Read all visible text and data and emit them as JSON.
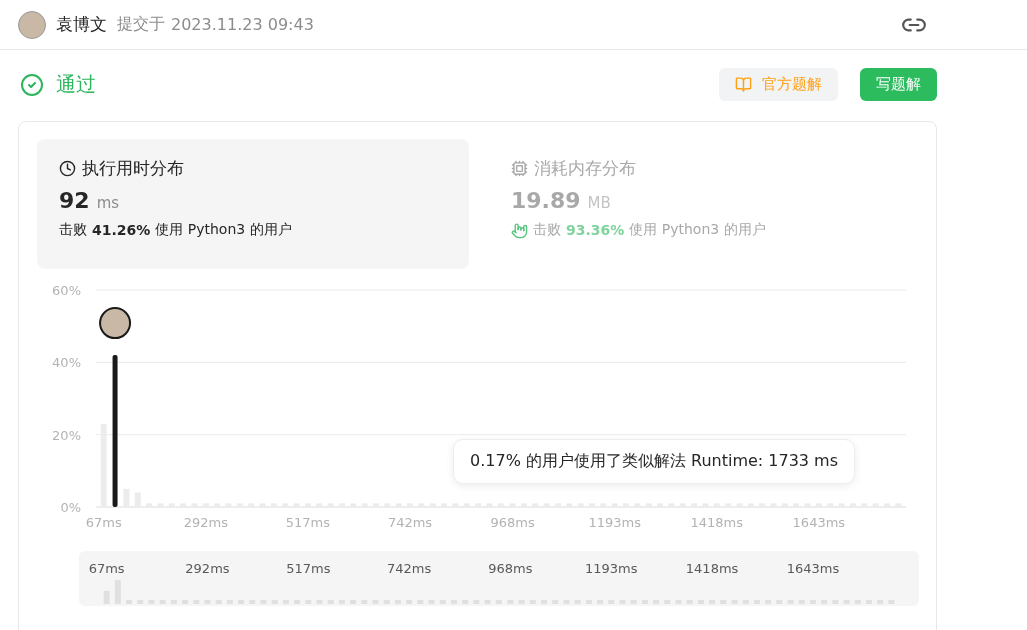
{
  "header": {
    "user": "袁博文",
    "submitted_label": "提交于",
    "submitted_time": "2023.11.23 09:43"
  },
  "status": {
    "label": "通过",
    "passed": true
  },
  "actions": [
    {
      "label": "官方题解",
      "kind": "secondary"
    },
    {
      "label": "写题解",
      "kind": "primary"
    }
  ],
  "stats": [
    {
      "title": "执行用时分布",
      "value": "92",
      "unit": "ms",
      "beat_prefix": "击败",
      "beat": "41.26%",
      "beat_suffix": "使用 Python3 的用户",
      "selected": true,
      "kind": "runtime"
    },
    {
      "title": "消耗内存分布",
      "value": "19.89",
      "unit": "MB",
      "beat_prefix": "击败",
      "beat": "93.36%",
      "beat_suffix": "使用 Python3 的用户",
      "selected": false,
      "kind": "memory"
    }
  ],
  "runtime_chart": {
    "tooltip": "0.17% 的用户使用了类似解法 Runtime: 1733 ms",
    "chart_data": {
      "type": "bar",
      "ylim": [
        0,
        60
      ],
      "yticks": [
        {
          "value": 0,
          "label": "0%"
        },
        {
          "value": 20,
          "label": "20%"
        },
        {
          "value": 40,
          "label": "40%"
        },
        {
          "value": 60,
          "label": "60%"
        }
      ],
      "xticks": [
        {
          "value": 67,
          "label": "67ms"
        },
        {
          "value": 292,
          "label": "292ms"
        },
        {
          "value": 517,
          "label": "517ms"
        },
        {
          "value": 742,
          "label": "742ms"
        },
        {
          "value": 968,
          "label": "968ms"
        },
        {
          "value": 1193,
          "label": "1193ms"
        },
        {
          "value": 1418,
          "label": "1418ms"
        },
        {
          "value": 1643,
          "label": "1643ms"
        }
      ],
      "xlim": [
        50,
        1835
      ],
      "x": [
        67,
        92,
        117,
        142,
        167,
        192,
        217,
        242,
        267,
        292,
        317,
        342,
        367,
        392,
        417,
        442,
        467,
        492,
        517,
        542,
        567,
        592,
        617,
        642,
        667,
        692,
        717,
        742,
        767,
        792,
        817,
        842,
        867,
        892,
        917,
        942,
        968,
        993,
        1018,
        1043,
        1068,
        1093,
        1118,
        1143,
        1168,
        1193,
        1218,
        1243,
        1268,
        1293,
        1318,
        1343,
        1368,
        1393,
        1418,
        1443,
        1468,
        1493,
        1518,
        1543,
        1568,
        1593,
        1618,
        1643,
        1668,
        1693,
        1718,
        1743,
        1768,
        1793,
        1818
      ],
      "values": [
        23,
        42,
        5,
        4,
        1,
        1,
        1,
        1,
        1,
        1,
        1,
        1,
        1,
        1,
        1,
        1,
        1,
        1,
        1,
        1,
        1,
        1,
        1,
        1,
        1,
        1,
        1,
        1,
        1,
        1,
        1,
        1,
        1,
        1,
        1,
        1,
        1,
        1,
        1,
        1,
        1,
        1,
        1,
        1,
        1,
        1,
        1,
        1,
        1,
        1,
        1,
        1,
        1,
        1,
        1,
        1,
        1,
        1,
        1,
        1,
        1,
        1,
        1,
        1,
        1,
        1,
        1,
        1,
        1,
        1,
        1
      ]
    }
  },
  "brush": {
    "labels": [
      "67ms",
      "292ms",
      "517ms",
      "742ms",
      "968ms",
      "1193ms",
      "1418ms",
      "1643ms"
    ]
  }
}
